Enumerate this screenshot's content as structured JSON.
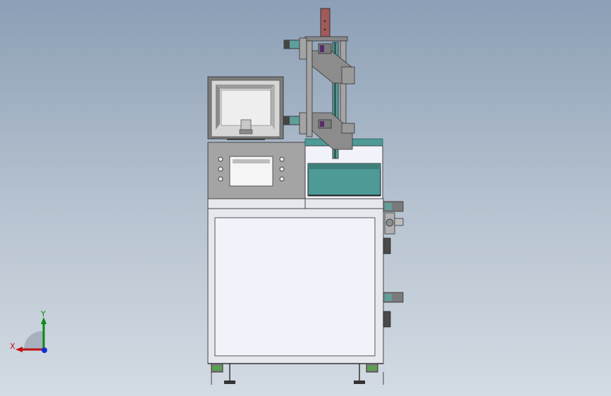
{
  "viewport": {
    "background_top": "#8c9fb6",
    "background_bottom": "#d3dbe3"
  },
  "machine": {
    "panel_color": "#a4a4a4",
    "frame_color": "#e6e8ee",
    "door_color": "#f2f2fa",
    "tray_color": "#4e9a96",
    "slide_color": "#5f9f9b",
    "accent_color": "#a05a5a",
    "purple_part_color": "#5a2a6a"
  },
  "triad": {
    "y_label": "Y",
    "x_label": "X",
    "y_color": "#0a8a12",
    "x_color": "#c01010",
    "z_color": "#1030d0"
  }
}
